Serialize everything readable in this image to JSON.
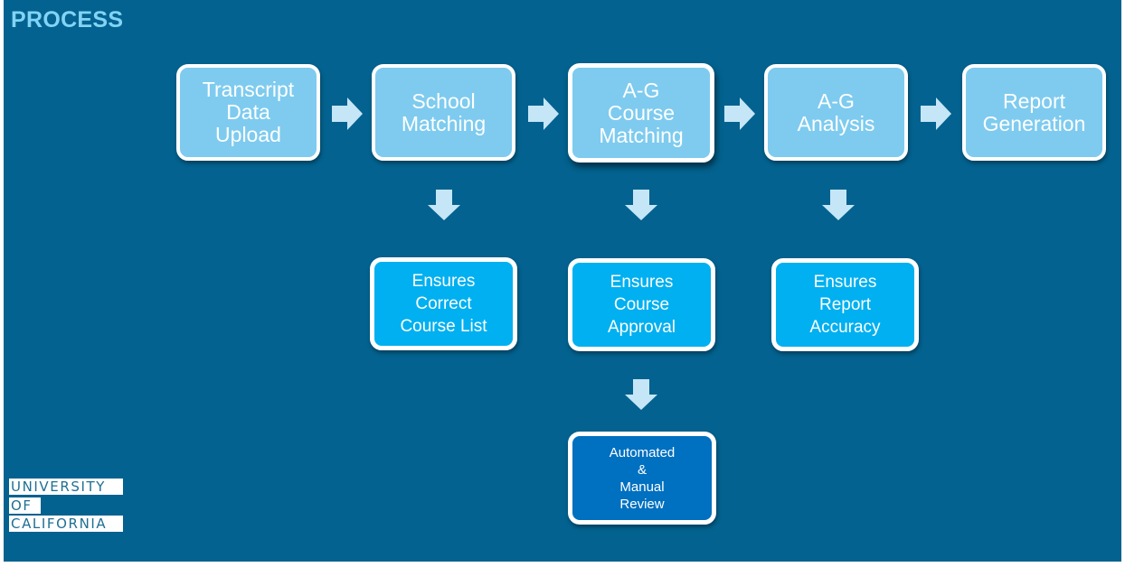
{
  "slide": {
    "title": "PROCESS",
    "colors": {
      "background": "#03628f",
      "title": "#82d3f5",
      "step_box": "#7ecbef",
      "check_box": "#00b0f0",
      "review_box": "#0070c0",
      "arrow": "#c5e6f7",
      "border": "#ffffff"
    }
  },
  "process_steps": [
    {
      "lines": [
        "Transcript",
        "Data",
        "Upload"
      ]
    },
    {
      "lines": [
        "School",
        "Matching"
      ]
    },
    {
      "lines": [
        "A-G",
        "Course",
        "Matching"
      ],
      "highlighted": true
    },
    {
      "lines": [
        "A-G",
        "Analysis"
      ]
    },
    {
      "lines": [
        "Report",
        "Generation"
      ]
    }
  ],
  "checks": [
    {
      "under_step": "School Matching",
      "lines": [
        "Ensures",
        "Correct",
        "Course List"
      ]
    },
    {
      "under_step": "A-G Course Matching",
      "lines": [
        "Ensures",
        "Course",
        "Approval"
      ]
    },
    {
      "under_step": "A-G Analysis",
      "lines": [
        "Ensures",
        "Report",
        "Accuracy"
      ]
    }
  ],
  "review": {
    "under_check": "Ensures Course Approval",
    "lines": [
      "Automated",
      "&",
      "Manual",
      "Review"
    ]
  },
  "arrows": {
    "right": [
      "right-arrow-icon",
      "right-arrow-icon",
      "right-arrow-icon",
      "right-arrow-icon"
    ],
    "down": [
      "down-arrow-icon",
      "down-arrow-icon",
      "down-arrow-icon",
      "down-arrow-icon"
    ]
  },
  "logo": {
    "lines": [
      "UNIVERSITY",
      "OF",
      "CALIFORNIA"
    ]
  }
}
